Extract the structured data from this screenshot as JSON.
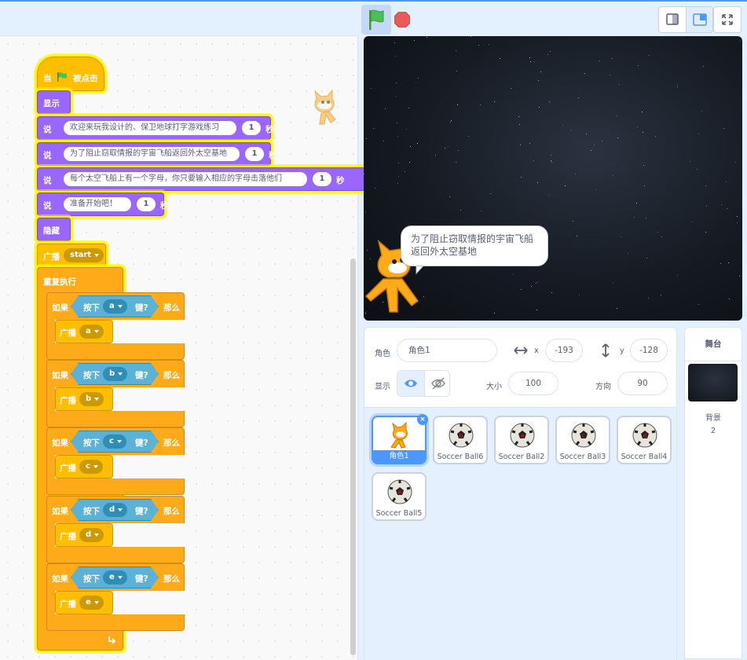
{
  "colors": {
    "accent": "#4c97ff",
    "events": "#ffbf00",
    "looks": "#9966ff",
    "control": "#ffab19",
    "sensing": "#5cb1d6",
    "highlight": "#fff200"
  },
  "toolbar": {
    "green_flag_icon": "green-flag-icon",
    "stop_icon": "stop-sign-icon",
    "small_stage_icon": "small-stage-icon",
    "normal_stage_icon": "normal-stage-icon",
    "fullscreen_icon": "fullscreen-icon"
  },
  "script": {
    "hat": {
      "when": "当",
      "clicked": "被点击"
    },
    "show": "显示",
    "say_label": "说",
    "sec_label": "秒",
    "says": [
      {
        "text": "欢迎来玩我设计的、保卫地球打字游戏练习",
        "secs": "1"
      },
      {
        "text": "为了阻止窃取情报的宇宙飞船返回外太空基地",
        "secs": "1"
      },
      {
        "text": "每个太空飞船上有一个字母，你只要输入相应的字母击落他们",
        "secs": "1"
      },
      {
        "text": "准备开始吧！",
        "secs": "1"
      }
    ],
    "hide": "隐藏",
    "broadcast_label": "广播",
    "broadcast_start": "start",
    "forever": "重复执行",
    "if_label": "如果",
    "then_label": "那么",
    "key_pressed_pre": "按下",
    "key_pressed_post": "键?",
    "ifs": [
      {
        "key": "a",
        "msg": "a"
      },
      {
        "key": "b",
        "msg": "b"
      },
      {
        "key": "c",
        "msg": "c"
      },
      {
        "key": "d",
        "msg": "d"
      },
      {
        "key": "e",
        "msg": "e"
      }
    ]
  },
  "stage": {
    "speech": "为了阻止窃取情报的宇宙飞船返回外太空基地"
  },
  "sprite_info": {
    "sprite_label": "角色",
    "sprite_name": "角色1",
    "x_label": "x",
    "x": "-193",
    "y_label": "y",
    "y": "-128",
    "show_label": "显示",
    "size_label": "大小",
    "size": "100",
    "direction_label": "方向",
    "direction": "90"
  },
  "sprites": [
    "角色1",
    "Soccer Ball6",
    "Soccer Ball2",
    "Soccer Ball3",
    "Soccer Ball4",
    "Soccer Ball5"
  ],
  "stage_panel": {
    "title": "舞台",
    "backdrops_label": "背景",
    "backdrops_count": "2"
  }
}
